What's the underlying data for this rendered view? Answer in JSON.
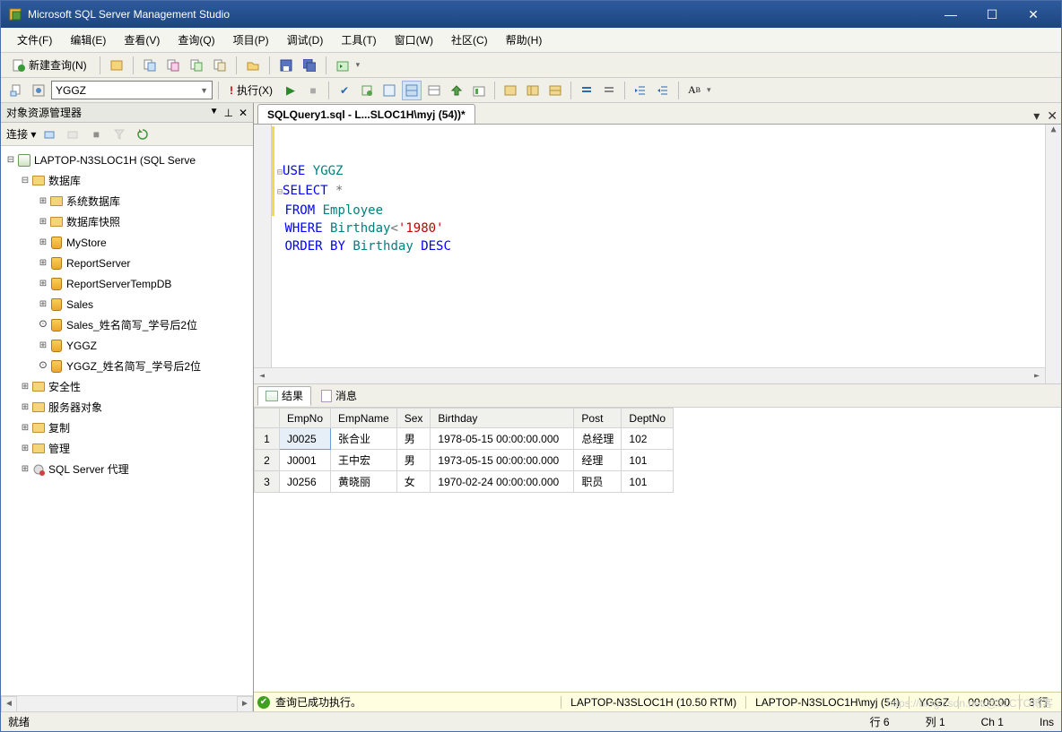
{
  "titlebar": {
    "title": "Microsoft SQL Server Management Studio"
  },
  "menu": {
    "file": "文件(F)",
    "edit": "编辑(E)",
    "view": "查看(V)",
    "query": "查询(Q)",
    "project": "项目(P)",
    "debug": "调试(D)",
    "tools": "工具(T)",
    "window": "窗口(W)",
    "community": "社区(C)",
    "help": "帮助(H)"
  },
  "toolbar": {
    "newquery": "新建查询(N)"
  },
  "toolbar2": {
    "db": "YGGZ",
    "execute": "执行(X)"
  },
  "objexp": {
    "title": "对象资源管理器",
    "connect": "连接 ▾",
    "root": "LAPTOP-N3SLOC1H (SQL Serve",
    "databases": "数据库",
    "sysdb": "系统数据库",
    "snapshot": "数据库快照",
    "db1": "MyStore",
    "db2": "ReportServer",
    "db3": "ReportServerTempDB",
    "db4": "Sales",
    "db5": "Sales_姓名简写_学号后2位",
    "db6": "YGGZ",
    "db7": "YGGZ_姓名简写_学号后2位",
    "security": "安全性",
    "serverobj": "服务器对象",
    "replication": "复制",
    "management": "管理",
    "agent": "SQL Server 代理"
  },
  "doctab": {
    "title": "SQLQuery1.sql - L...SLOC1H\\myj (54))*"
  },
  "sql": {
    "l1a": "USE",
    "l1b": "YGGZ",
    "l2a": "SELECT",
    "l2b": "*",
    "l3a": "FROM",
    "l3b": "Employee",
    "l4a": "WHERE",
    "l4b": "Birthday",
    "l4c": "<",
    "l4d": "'1980'",
    "l5a": "ORDER",
    "l5b": "BY",
    "l5c": "Birthday",
    "l5d": "DESC"
  },
  "restabs": {
    "results": "结果",
    "messages": "消息"
  },
  "grid": {
    "headers": {
      "c1": "EmpNo",
      "c2": "EmpName",
      "c3": "Sex",
      "c4": "Birthday",
      "c5": "Post",
      "c6": "DeptNo"
    },
    "r1": {
      "n": "1",
      "c1": "J0025",
      "c2": "张合业",
      "c3": "男",
      "c4": "1978-05-15 00:00:00.000",
      "c5": "总经理",
      "c6": "102"
    },
    "r2": {
      "n": "2",
      "c1": "J0001",
      "c2": "王中宏",
      "c3": "男",
      "c4": "1973-05-15 00:00:00.000",
      "c5": "经理",
      "c6": "101"
    },
    "r3": {
      "n": "3",
      "c1": "J0256",
      "c2": "黄晓丽",
      "c3": "女",
      "c4": "1970-02-24 00:00:00.000",
      "c5": "职员",
      "c6": "101"
    }
  },
  "status2": {
    "msg": "查询已成功执行。",
    "server": "LAPTOP-N3SLOC1H (10.50 RTM)",
    "login": "LAPTOP-N3SLOC1H\\myj (54)",
    "db": "YGGZ",
    "time": "00:00:00",
    "rows": "3 行"
  },
  "status": {
    "ready": "就绪",
    "line": "行 6",
    "col": "列 1",
    "ch": "Ch 1",
    "ins": "Ins"
  },
  "watermark": "https://blog.csdn.net/@51CTO博客"
}
